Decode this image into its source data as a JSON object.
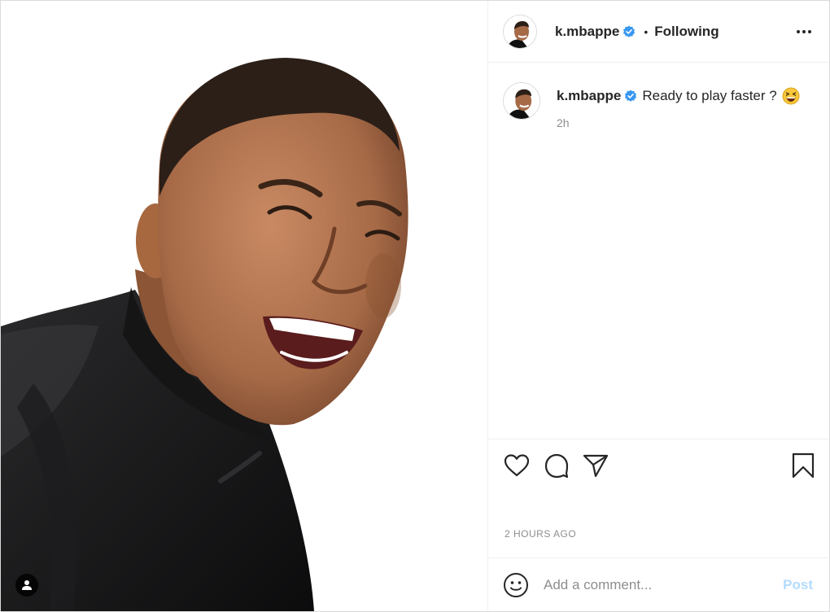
{
  "post": {
    "image_alt": "Smiling man in a black athletic top",
    "accent_color": "#3897f0",
    "header": {
      "username": "k.mbappe",
      "separator": "•",
      "follow_status": "Following"
    },
    "caption": {
      "username": "k.mbappe",
      "text": "Ready to play faster ?",
      "emoji": "grinning-squinting-face",
      "relative_time": "2h"
    },
    "actions": [
      "like",
      "comment",
      "share",
      "save"
    ],
    "timestamp": "2 hours ago",
    "comment_box": {
      "placeholder": "Add a comment...",
      "post_label": "Post"
    }
  }
}
